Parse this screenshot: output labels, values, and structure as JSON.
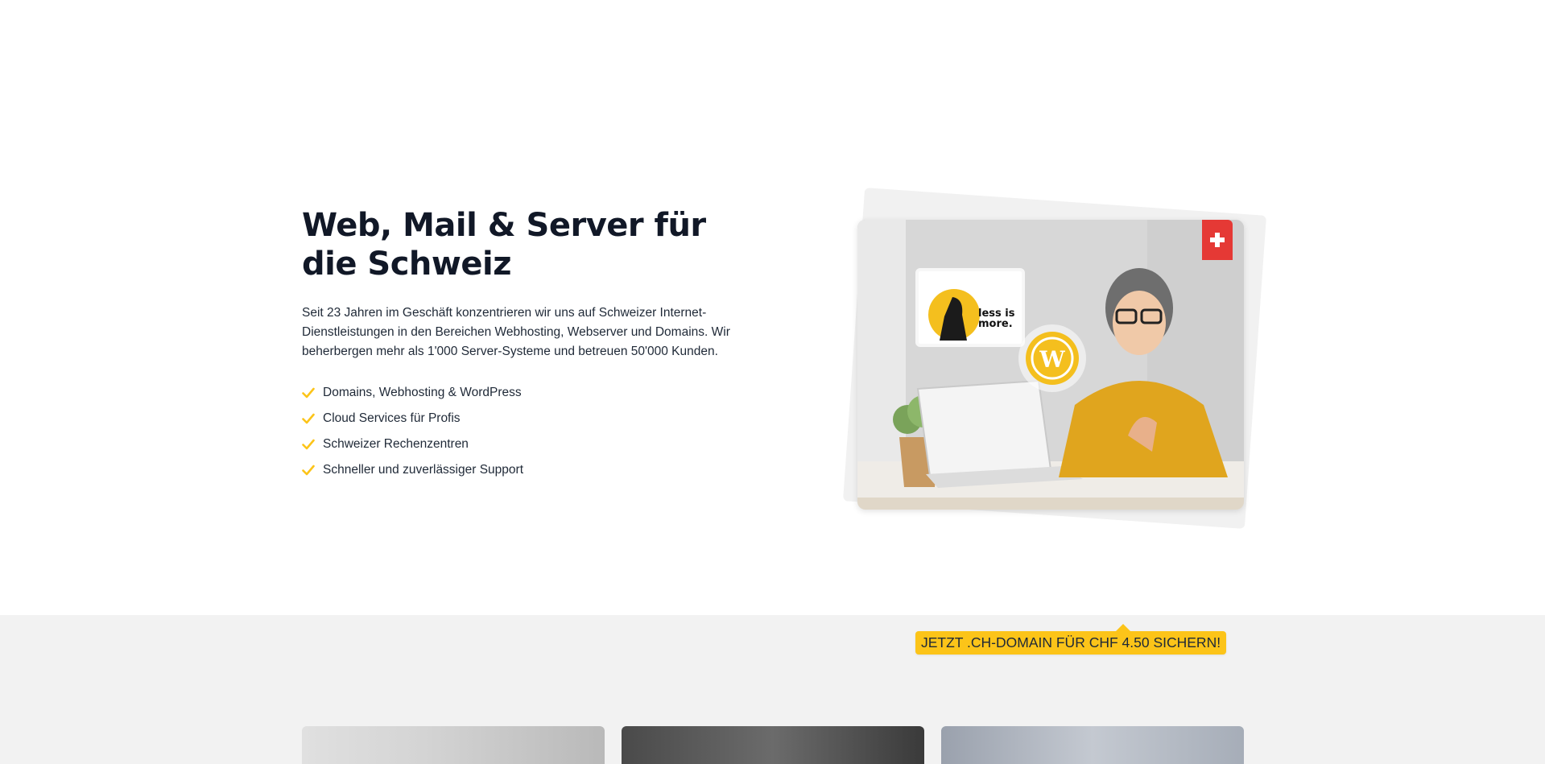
{
  "hero": {
    "title": "Web, Mail & Server für die Schweiz",
    "description": "Seit 23 Jahren im Geschäft konzentrieren wir uns auf Schweizer Internet-Dienstleistungen in den Bereichen Webhosting, Webserver und Domains. Wir beherbergen mehr als 1'000 Server-Systeme und betreuen 50'000 Kunden.",
    "features": [
      "Domains, Webhosting & WordPress",
      "Cloud Services für Profis",
      "Schweizer Rechenzentren",
      "Schneller und zuverlässiger Support"
    ],
    "check_icon": "check-icon",
    "image_overlay_text": "less is more."
  },
  "promo": {
    "label": "JETZT .CH-DOMAIN FÜR CHF 4.50 SICHERN!"
  },
  "colors": {
    "accent": "#fcc419",
    "flag": "#e53935",
    "title": "#111827",
    "band": "#f2f2f2"
  }
}
